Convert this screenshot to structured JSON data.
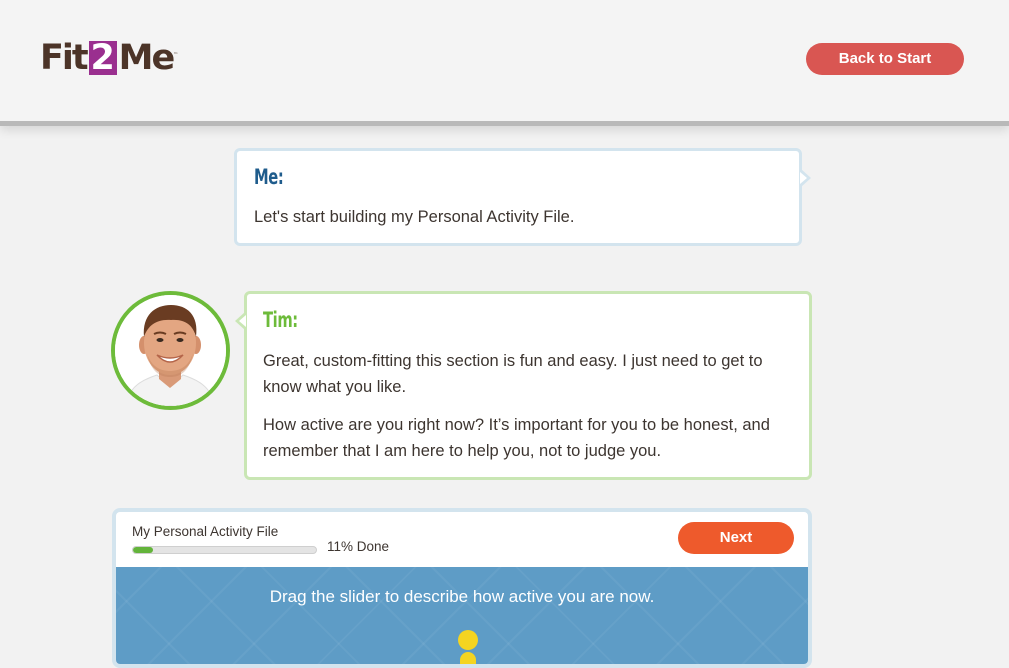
{
  "header": {
    "logo": {
      "prefix": "Fit",
      "number": "2",
      "suffix": "Me",
      "trademark": "™"
    },
    "back_button": "Back to Start"
  },
  "conversation": {
    "me": {
      "speaker": "Me:",
      "message": "Let's start building my Personal Activity File."
    },
    "tim": {
      "speaker": "Tim:",
      "paragraph1": "Great, custom-fitting this section is fun and easy. I just need to get to know what you like.",
      "paragraph2": "How active are you right now? It’s important for you to be honest, and remember that I am here to help you, not to judge you."
    }
  },
  "activity_panel": {
    "title": "My Personal Activity File",
    "progress_percent": 11,
    "progress_text": "11% Done",
    "next_button": "Next",
    "instruction": "Drag the slider to describe how active you are now."
  },
  "colors": {
    "back_button": "#d95652",
    "next_button": "#ee5a2c",
    "me_speaker": "#1f5c8c",
    "tim_speaker": "#6dbb3a",
    "slider_background": "#5e9cc6",
    "slider_knob": "#f4d421",
    "logo_accent": "#9a2f8f"
  }
}
